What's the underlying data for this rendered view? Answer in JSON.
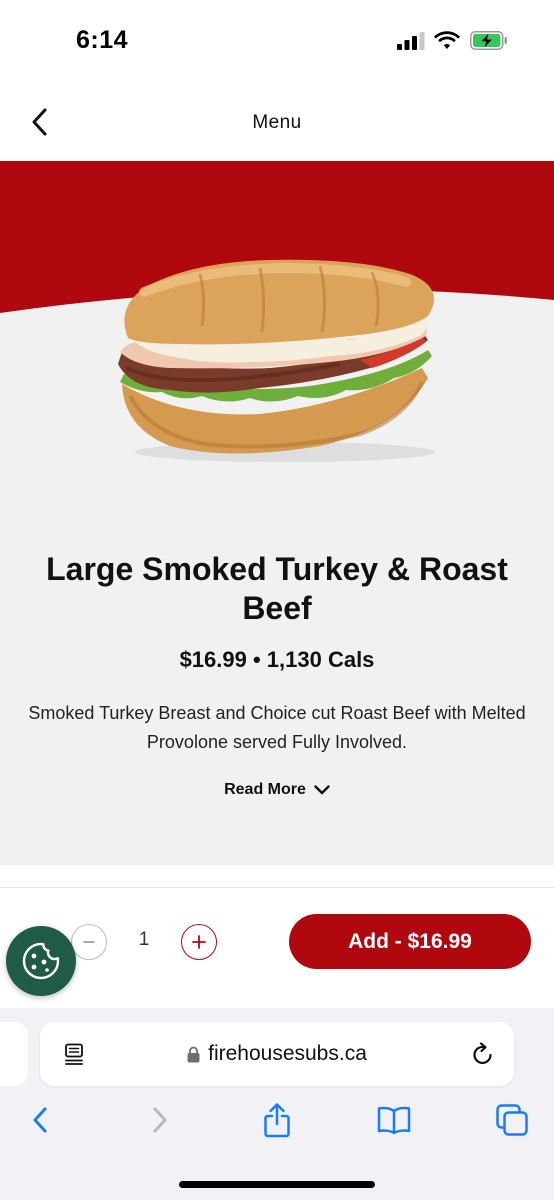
{
  "status_bar": {
    "time": "6:14"
  },
  "header": {
    "title": "Menu"
  },
  "product": {
    "title": "Large Smoked Turkey & Roast Beef",
    "price_line": "$16.99 • 1,130 Cals",
    "price": "$16.99",
    "calories": "1,130 Cals",
    "description": "Smoked Turkey Breast and Choice cut Roast Beef with Melted Provolone served Fully Involved.",
    "read_more_label": "Read More"
  },
  "order": {
    "quantity": "1",
    "add_label": "Add - $16.99"
  },
  "browser": {
    "url": "firehousesubs.ca"
  },
  "icons": {
    "back": "chevron-left-icon",
    "chevron_down": "chevron-down-icon",
    "cookie": "cookie-icon",
    "reader": "reader-mode-icon",
    "lock": "lock-icon",
    "reload": "reload-icon",
    "share": "share-icon",
    "bookmarks": "book-icon",
    "tabs": "tabs-icon"
  },
  "colors": {
    "brand_red": "#b0080f",
    "hero_bg": "#f1f1f1",
    "cookie_green": "#1f5b45",
    "ios_blue": "#1a7cf5"
  }
}
